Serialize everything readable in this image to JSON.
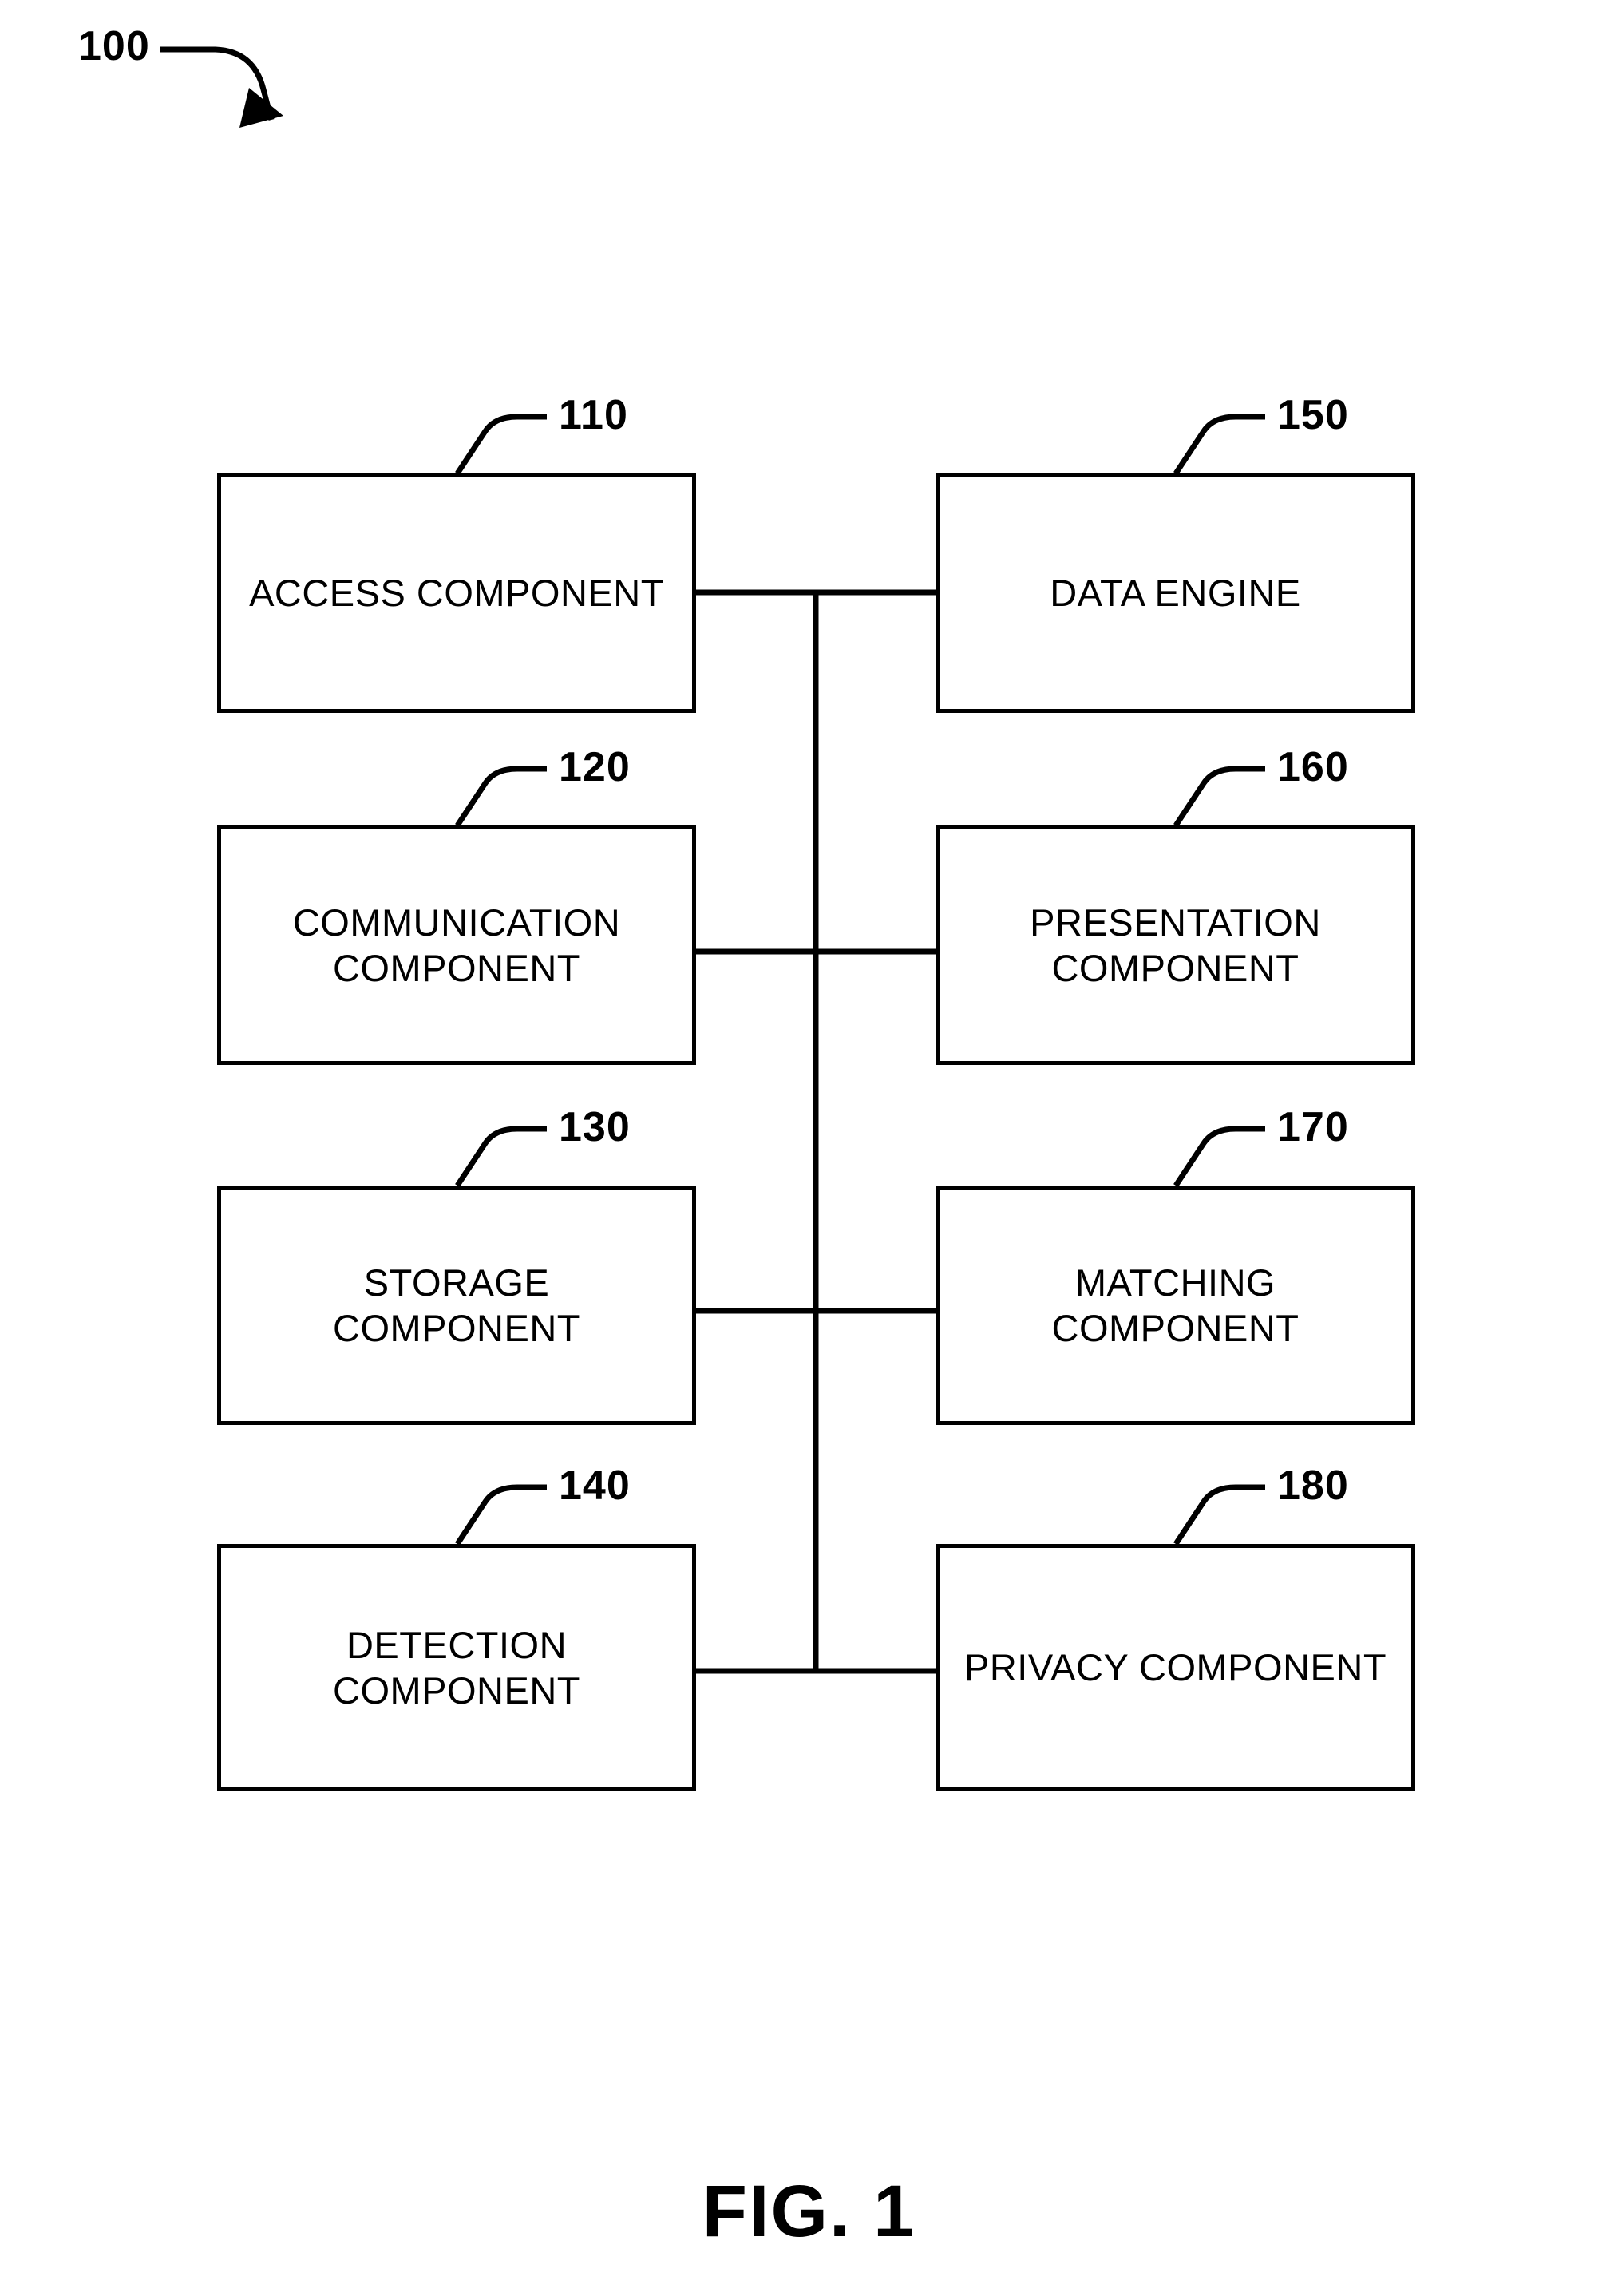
{
  "figure": {
    "system_number": "100",
    "caption": "FIG. 1",
    "line_color": "#000000",
    "background_color": "#ffffff"
  },
  "blocks": [
    {
      "ref": "110",
      "label": "ACCESS COMPONENT",
      "column": "left",
      "row": 1
    },
    {
      "ref": "120",
      "label": "COMMUNICATION\nCOMPONENT",
      "column": "left",
      "row": 2
    },
    {
      "ref": "130",
      "label": "STORAGE\nCOMPONENT",
      "column": "left",
      "row": 3
    },
    {
      "ref": "140",
      "label": "DETECTION\nCOMPONENT",
      "column": "left",
      "row": 4
    },
    {
      "ref": "150",
      "label": "DATA ENGINE",
      "column": "right",
      "row": 1
    },
    {
      "ref": "160",
      "label": "PRESENTATION\nCOMPONENT",
      "column": "right",
      "row": 2
    },
    {
      "ref": "170",
      "label": "MATCHING\nCOMPONENT",
      "column": "right",
      "row": 3
    },
    {
      "ref": "180",
      "label": "PRIVACY COMPONENT",
      "column": "right",
      "row": 4
    }
  ]
}
